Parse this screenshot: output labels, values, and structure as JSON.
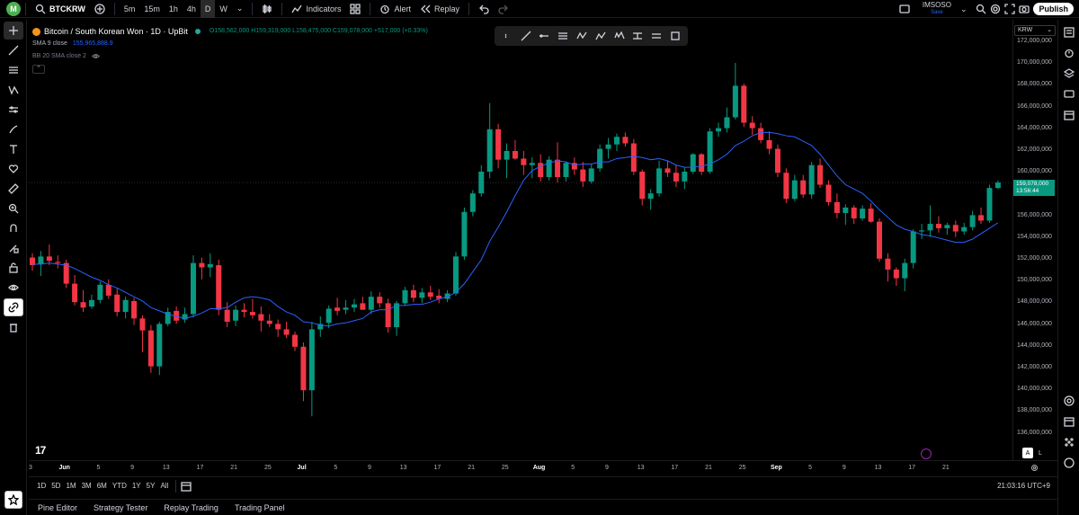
{
  "topbar": {
    "avatar_letter": "M",
    "symbol": "BTCKRW",
    "intervals": [
      "5m",
      "15m",
      "1h",
      "4h",
      "D",
      "W"
    ],
    "active_interval": "D",
    "indicators_label": "Indicators",
    "alert_label": "Alert",
    "replay_label": "Replay",
    "layout_name": "IMSOSO",
    "layout_status": "Save",
    "publish_label": "Publish"
  },
  "legend": {
    "title": "Bitcoin / South Korean Won · 1D · UpBit",
    "ohlc": "O158,562,000 H159,319,000 L158,475,000 C159,078,000 +517,000 (+0.33%)",
    "sma_label": "SMA 9 close",
    "sma_value": "155,965,888.9",
    "bb_label": "BB 20 SMA close 2"
  },
  "price_scale": {
    "currency": "KRW",
    "labels": [
      "172,000,000",
      "170,000,000",
      "168,000,000",
      "166,000,000",
      "164,000,000",
      "162,000,000",
      "160,000,000",
      "158,000,000",
      "156,000,000",
      "154,000,000",
      "152,000,000",
      "150,000,000",
      "148,000,000",
      "146,000,000",
      "144,000,000",
      "142,000,000",
      "140,000,000",
      "138,000,000",
      "136,000,000"
    ],
    "last_price": "159,078,000",
    "countdown": "13:56:44"
  },
  "time_axis": {
    "labels": [
      "3",
      "Jun",
      "5",
      "9",
      "13",
      "17",
      "21",
      "25",
      "Jul",
      "5",
      "9",
      "13",
      "17",
      "21",
      "25",
      "Aug",
      "5",
      "9",
      "13",
      "17",
      "21",
      "25",
      "Sep",
      "5",
      "9",
      "13",
      "17",
      "21"
    ],
    "months": [
      "Jun",
      "Jul",
      "Aug",
      "Sep"
    ]
  },
  "bottombar": {
    "ranges": [
      "1D",
      "5D",
      "1M",
      "3M",
      "6M",
      "YTD",
      "1Y",
      "5Y",
      "All"
    ],
    "clock": "21:03:16 UTC+9"
  },
  "panels": [
    "Pine Editor",
    "Strategy Tester",
    "Replay Trading",
    "Trading Panel"
  ],
  "toggles": {
    "auto": "A",
    "log": "L"
  },
  "colors": {
    "up": "#089981",
    "down": "#f23645",
    "sma": "#2962ff",
    "background": "#000000"
  },
  "chart_data": {
    "type": "candlestick",
    "y_unit": "KRW",
    "ylim": [
      135000000,
      173000000
    ],
    "candles": [
      [
        152.2,
        152.6,
        151.0,
        151.5
      ],
      [
        151.6,
        152.8,
        150.5,
        152.3
      ],
      [
        152.3,
        153.4,
        151.5,
        151.9
      ],
      [
        151.8,
        152.4,
        151.2,
        151.7
      ],
      [
        151.7,
        152.0,
        149.4,
        149.8
      ],
      [
        149.8,
        150.6,
        147.8,
        148.1
      ],
      [
        148.1,
        149.2,
        147.2,
        147.6
      ],
      [
        147.7,
        148.8,
        147.5,
        148.3
      ],
      [
        148.3,
        150.0,
        148.0,
        149.7
      ],
      [
        149.7,
        150.2,
        148.4,
        148.7
      ],
      [
        148.8,
        149.4,
        146.8,
        147.2
      ],
      [
        147.2,
        148.6,
        146.6,
        148.3
      ],
      [
        148.2,
        148.5,
        146.0,
        146.6
      ],
      [
        146.6,
        146.9,
        143.5,
        145.5
      ],
      [
        145.5,
        146.0,
        141.6,
        142.2
      ],
      [
        142.2,
        146.3,
        141.4,
        146.1
      ],
      [
        146.1,
        147.6,
        145.9,
        147.2
      ],
      [
        147.3,
        147.7,
        146.1,
        146.4
      ],
      [
        146.5,
        147.6,
        146.2,
        147.0
      ],
      [
        147.0,
        152.4,
        146.7,
        151.7
      ],
      [
        151.7,
        152.2,
        150.2,
        151.3
      ],
      [
        151.3,
        152.6,
        150.4,
        151.6
      ],
      [
        151.5,
        152.0,
        146.9,
        147.4
      ],
      [
        147.4,
        148.1,
        145.8,
        146.3
      ],
      [
        146.4,
        147.8,
        145.9,
        147.4
      ],
      [
        147.4,
        148.0,
        146.7,
        147.2
      ],
      [
        147.2,
        148.4,
        146.6,
        146.9
      ],
      [
        147.0,
        147.7,
        145.4,
        146.4
      ],
      [
        146.4,
        147.0,
        145.8,
        146.1
      ],
      [
        146.1,
        146.5,
        144.9,
        145.6
      ],
      [
        145.6,
        146.3,
        144.8,
        145.1
      ],
      [
        145.1,
        145.4,
        143.6,
        144.0
      ],
      [
        144.0,
        144.4,
        139.0,
        140.0
      ],
      [
        140.0,
        146.3,
        137.6,
        145.6
      ],
      [
        145.6,
        146.8,
        144.9,
        146.1
      ],
      [
        146.2,
        147.8,
        145.7,
        147.5
      ],
      [
        147.6,
        148.5,
        146.9,
        147.3
      ],
      [
        147.4,
        148.3,
        147.0,
        147.6
      ],
      [
        147.6,
        148.4,
        147.2,
        147.9
      ],
      [
        148.0,
        148.6,
        147.4,
        147.4
      ],
      [
        147.4,
        149.1,
        147.0,
        148.6
      ],
      [
        148.6,
        149.0,
        147.6,
        148.0
      ],
      [
        148.0,
        148.4,
        145.3,
        145.8
      ],
      [
        145.8,
        148.2,
        145.0,
        148.0
      ],
      [
        148.0,
        149.5,
        147.8,
        149.2
      ],
      [
        149.2,
        149.7,
        148.1,
        148.5
      ],
      [
        148.5,
        149.4,
        148.0,
        149.0
      ],
      [
        149.0,
        149.6,
        148.3,
        148.6
      ],
      [
        148.7,
        149.3,
        148.0,
        148.4
      ],
      [
        148.4,
        149.2,
        148.1,
        148.9
      ],
      [
        148.9,
        152.7,
        148.7,
        152.3
      ],
      [
        152.3,
        156.8,
        152.0,
        156.4
      ],
      [
        156.4,
        158.4,
        156.0,
        158.1
      ],
      [
        158.1,
        160.7,
        157.8,
        160.1
      ],
      [
        160.1,
        166.4,
        159.5,
        164.0
      ],
      [
        164.0,
        164.5,
        160.4,
        161.2
      ],
      [
        161.2,
        162.7,
        159.5,
        162.0
      ],
      [
        162.0,
        163.0,
        161.2,
        161.3
      ],
      [
        161.3,
        162.0,
        159.8,
        160.7
      ],
      [
        160.7,
        161.4,
        159.5,
        160.9
      ],
      [
        160.9,
        161.7,
        159.2,
        159.6
      ],
      [
        159.6,
        161.5,
        159.3,
        161.2
      ],
      [
        161.2,
        162.8,
        159.1,
        159.6
      ],
      [
        159.6,
        161.0,
        159.2,
        160.9
      ],
      [
        160.9,
        161.4,
        159.8,
        160.3
      ],
      [
        160.3,
        161.0,
        158.7,
        159.2
      ],
      [
        159.2,
        160.8,
        159.0,
        160.4
      ],
      [
        160.4,
        162.6,
        160.1,
        162.2
      ],
      [
        162.2,
        163.2,
        161.3,
        162.6
      ],
      [
        162.6,
        163.6,
        162.0,
        163.3
      ],
      [
        163.3,
        163.7,
        162.4,
        162.7
      ],
      [
        162.7,
        163.1,
        159.8,
        160.1
      ],
      [
        160.1,
        160.3,
        157.0,
        157.6
      ],
      [
        157.6,
        158.5,
        156.6,
        158.1
      ],
      [
        158.1,
        161.1,
        157.8,
        160.4
      ],
      [
        160.4,
        161.1,
        159.6,
        160.0
      ],
      [
        160.0,
        160.7,
        158.7,
        159.2
      ],
      [
        159.2,
        160.5,
        158.5,
        160.1
      ],
      [
        160.1,
        161.8,
        159.9,
        161.7
      ],
      [
        161.7,
        161.8,
        159.8,
        160.1
      ],
      [
        160.1,
        164.1,
        159.9,
        163.8
      ],
      [
        163.8,
        164.6,
        163.3,
        164.1
      ],
      [
        164.1,
        166.0,
        163.7,
        165.1
      ],
      [
        165.1,
        170.1,
        164.9,
        168.0
      ],
      [
        168.0,
        168.2,
        164.2,
        164.6
      ],
      [
        164.6,
        165.2,
        163.5,
        164.1
      ],
      [
        164.1,
        164.6,
        162.7,
        163.0
      ],
      [
        163.0,
        163.8,
        161.7,
        162.2
      ],
      [
        162.2,
        162.6,
        159.6,
        160.0
      ],
      [
        160.0,
        160.4,
        157.2,
        157.6
      ],
      [
        157.6,
        159.8,
        157.4,
        159.3
      ],
      [
        159.3,
        159.8,
        157.7,
        158.0
      ],
      [
        158.0,
        161.0,
        157.6,
        160.7
      ],
      [
        160.7,
        161.3,
        158.6,
        158.9
      ],
      [
        158.9,
        159.3,
        157.0,
        157.3
      ],
      [
        157.3,
        158.1,
        155.8,
        156.3
      ],
      [
        156.3,
        157.1,
        155.2,
        156.8
      ],
      [
        156.8,
        157.0,
        155.3,
        155.8
      ],
      [
        155.8,
        157.0,
        155.6,
        156.7
      ],
      [
        156.7,
        157.2,
        155.4,
        155.5
      ],
      [
        155.5,
        155.8,
        151.8,
        152.1
      ],
      [
        152.1,
        152.6,
        150.0,
        151.1
      ],
      [
        151.1,
        151.3,
        149.6,
        150.3
      ],
      [
        150.3,
        152.1,
        149.1,
        151.7
      ],
      [
        151.7,
        154.8,
        151.2,
        154.6
      ],
      [
        154.6,
        155.3,
        153.9,
        154.7
      ],
      [
        154.7,
        157.0,
        154.1,
        155.3
      ],
      [
        155.3,
        156.0,
        154.5,
        154.9
      ],
      [
        154.9,
        155.4,
        154.3,
        155.2
      ],
      [
        155.2,
        155.6,
        154.1,
        154.6
      ],
      [
        154.6,
        155.4,
        154.3,
        155.0
      ],
      [
        155.0,
        156.5,
        154.7,
        156.1
      ],
      [
        156.1,
        156.8,
        155.3,
        155.6
      ],
      [
        155.6,
        158.9,
        155.4,
        158.6
      ],
      [
        158.6,
        159.3,
        158.5,
        159.1
      ]
    ],
    "sma9": {
      "name": "SMA 9 close",
      "values": [
        151.6,
        151.6,
        151.7,
        151.6,
        151.5,
        151.2,
        150.8,
        150.4,
        150.1,
        149.7,
        149.4,
        149.0,
        148.6,
        148.2,
        147.6,
        147.3,
        147.0,
        146.8,
        146.6,
        146.8,
        147.1,
        147.5,
        147.5,
        147.6,
        148.1,
        148.5,
        148.6,
        148.5,
        148.3,
        147.7,
        147.2,
        146.9,
        146.3,
        146.2,
        146.0,
        145.9,
        146.1,
        146.2,
        146.4,
        146.6,
        147.2,
        147.4,
        147.4,
        147.8,
        147.8,
        147.9,
        147.9,
        148.1,
        148.4,
        148.6,
        149.0,
        149.8,
        150.9,
        152.0,
        153.7,
        155.0,
        156.4,
        157.9,
        159.3,
        160.2,
        160.6,
        160.9,
        161.1,
        161.0,
        160.7,
        160.8,
        160.8,
        161.0,
        161.0,
        161.3,
        161.4,
        161.5,
        161.4,
        161.2,
        161.3,
        161.1,
        160.7,
        160.5,
        160.5,
        160.6,
        160.8,
        161.2,
        161.7,
        162.5,
        162.9,
        163.4,
        163.7,
        163.7,
        163.6,
        163.4,
        163.3,
        162.9,
        162.5,
        161.7,
        160.7,
        159.7,
        158.9,
        158.5,
        158.1,
        157.4,
        156.6,
        155.9,
        155.2,
        154.8,
        154.6,
        154.3,
        154.2,
        154.0,
        153.8,
        153.6,
        153.6,
        153.9,
        154.4,
        154.9,
        155.4
      ]
    },
    "last_price": 159078000,
    "price_line": 159.1
  }
}
